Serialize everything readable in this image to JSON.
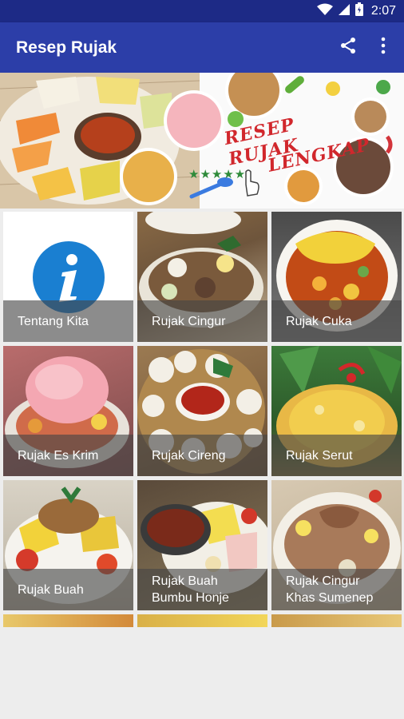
{
  "status_bar": {
    "time": "2:07",
    "icons": [
      "wifi-icon",
      "signal-icon",
      "battery-icon"
    ]
  },
  "app_bar": {
    "title": "Resep Rujak",
    "actions": [
      "share-icon",
      "overflow-menu-icon"
    ],
    "color": "#2c3ea8",
    "status_color": "#1d2a86"
  },
  "banner": {
    "line1": "RESEP RUJAK",
    "line2": "LENGKAP",
    "stars": "★★★★★"
  },
  "tiles": [
    {
      "label": "Tentang Kita",
      "icon": "info-icon"
    },
    {
      "label": "Rujak Cingur"
    },
    {
      "label": "Rujak Cuka"
    },
    {
      "label": "Rujak Es Krim"
    },
    {
      "label": "Rujak Cireng"
    },
    {
      "label": "Rujak Serut"
    },
    {
      "label": "Rujak Buah"
    },
    {
      "label": "Rujak Buah Bumbu Honje"
    },
    {
      "label": "Rujak Cingur Khas Sumenep"
    }
  ]
}
